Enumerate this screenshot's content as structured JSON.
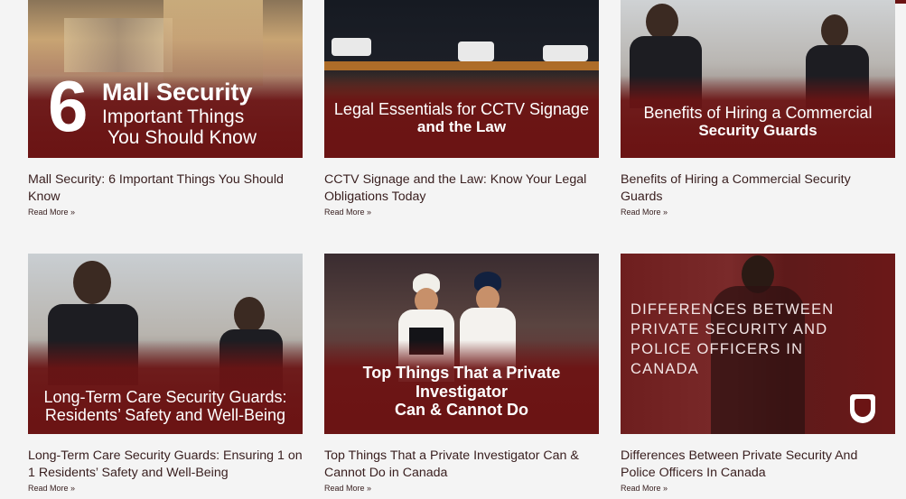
{
  "colors": {
    "brand_maroon": "#6b1414",
    "page_bg": "#f4f4f4",
    "title_text": "#3a2020"
  },
  "posts": [
    {
      "overlay_big": "6",
      "overlay_lines": [
        "Mall Security",
        "Important Things",
        "You Should Know"
      ],
      "title": "Mall Security: 6 Important Things You Should Know",
      "read_more": "Read More »"
    },
    {
      "overlay_lines": [
        "Legal Essentials for CCTV Signage",
        "and the Law"
      ],
      "title": "CCTV Signage and the Law: Know Your Legal Obligations Today",
      "read_more": "Read More »"
    },
    {
      "overlay_lines": [
        "Benefits of Hiring a Commercial",
        "Security Guards"
      ],
      "title": "Benefits of Hiring a Commercial Security Guards",
      "read_more": "Read More »"
    },
    {
      "overlay_lines": [
        "Long-Term Care Security Guards:",
        "Residents’ Safety and Well-Being"
      ],
      "title": "Long-Term Care Security Guards: Ensuring 1 on 1 Residents’ Safety and Well-Being",
      "read_more": "Read More »"
    },
    {
      "overlay_lines": [
        "Top Things That a Private",
        "Investigator",
        "Can & Cannot Do"
      ],
      "title": "Top Things That a Private Investigator Can & Cannot Do in Canada",
      "read_more": "Read More »"
    },
    {
      "overlay_lines": [
        "DIFFERENCES BETWEEN",
        "PRIVATE SECURITY AND",
        "POLICE OFFICERS IN",
        "CANADA"
      ],
      "title": "Differences Between Private Security And Police Officers In Canada",
      "read_more": "Read More »"
    }
  ]
}
